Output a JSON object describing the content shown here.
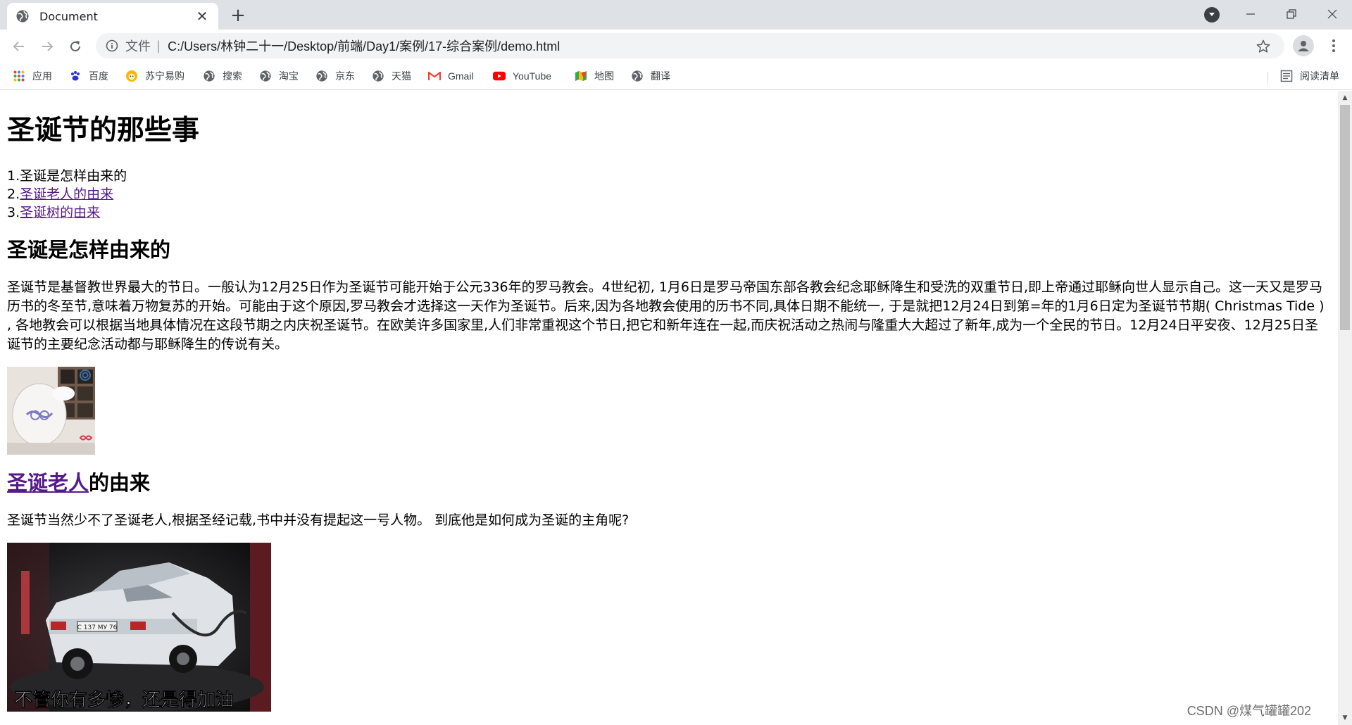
{
  "browser": {
    "tab_title": "Document",
    "scheme_label": "文件",
    "url": "C:/Users/林钟二十一/Desktop/前端/Day1/案例/17-综合案例/demo.html",
    "bookmarks": [
      {
        "label": "应用",
        "icon": "apps-grid-icon"
      },
      {
        "label": "百度",
        "icon": "baidu-paw-icon"
      },
      {
        "label": "苏宁易购",
        "icon": "suning-icon"
      },
      {
        "label": "搜索",
        "icon": "globe-icon"
      },
      {
        "label": "淘宝",
        "icon": "globe-icon"
      },
      {
        "label": "京东",
        "icon": "globe-icon"
      },
      {
        "label": "天猫",
        "icon": "globe-icon"
      },
      {
        "label": "Gmail",
        "icon": "gmail-icon"
      },
      {
        "label": "YouTube",
        "icon": "youtube-icon"
      },
      {
        "label": "地图",
        "icon": "maps-icon"
      },
      {
        "label": "翻译",
        "icon": "globe-icon"
      }
    ],
    "reading_list": "阅读清单"
  },
  "page": {
    "title": "圣诞节的那些事",
    "toc": [
      {
        "num": "1.",
        "text": "圣诞是怎样由来的",
        "link": false
      },
      {
        "num": "2.",
        "text": "圣诞老人的由来",
        "link": true
      },
      {
        "num": "3.",
        "text": "圣诞树的由来",
        "link": true
      }
    ],
    "section1": {
      "heading": "圣诞是怎样由来的",
      "paragraph": "圣诞节是基督教世界最大的节日。一般认为12月25日作为圣诞节可能开始于公元336年的罗马教会。4世纪初, 1月6日是罗马帝国东部各教会纪念耶稣降生和受洗的双重节日,即上帝通过耶稣向世人显示自己。这一天又是罗马历书的冬至节,意味着万物复苏的开始。可能由于这个原因,罗马教会才选择这一天作为圣诞节。后来,因为各地教会使用的历书不同,具体日期不能统一, 于是就把12月24日到第=年的1月6日定为圣诞节节期( Christmas Tide ) , 各地教会可以根据当地具体情况在这段节期之内庆祝圣诞节。在欧美许多国家里,人们非常重视这个节日,把它和新年连在一起,而庆祝活动之热闹与隆重大大超过了新年,成为一个全民的节日。12月24日平安夜、12月25日圣诞节的主要纪念活动都与耶稣降生的传说有关。"
    },
    "section2": {
      "heading_link": "圣诞老人",
      "heading_rest": "的由来",
      "paragraph": "圣诞节当然少不了圣诞老人,根据圣经记载,书中并没有提起这一号人物。 到底他是如何成为圣诞的主角呢?",
      "image_caption": "不管你有多惨，还是得加油",
      "plate": "С 137 МУ 76"
    },
    "watermark": "CSDN @煤气罐罐202"
  },
  "colors": {
    "tabstrip_bg": "#dee1e6",
    "omnibox_bg": "#f1f3f4",
    "visited_link": "#551a8b"
  }
}
